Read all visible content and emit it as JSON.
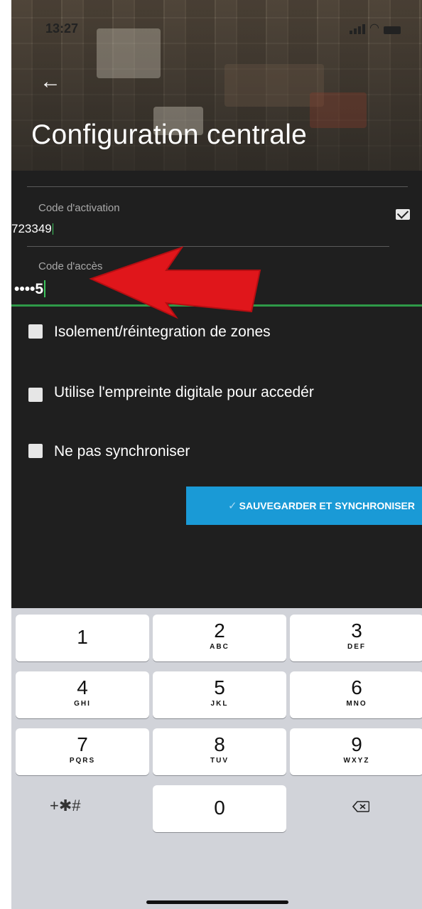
{
  "status_bar": {
    "time": "13:27"
  },
  "header": {
    "title": "Configuration centrale"
  },
  "form": {
    "activation": {
      "label": "Code d'activation",
      "value": "723349"
    },
    "access": {
      "label": "Code d'accès",
      "value": "••••5"
    }
  },
  "options": [
    {
      "label": "Isolement/réintegration de zones",
      "checked": false
    },
    {
      "label": "Utilise l'empreinte digitale pour accedér",
      "checked": false
    },
    {
      "label": "Ne pas synchroniser",
      "checked": false
    }
  ],
  "save_button": {
    "label": "SAUVEGARDER ET SYNCHRONISER"
  },
  "keyboard": {
    "keys": [
      {
        "digit": "1",
        "letters": ""
      },
      {
        "digit": "2",
        "letters": "ABC"
      },
      {
        "digit": "3",
        "letters": "DEF"
      },
      {
        "digit": "4",
        "letters": "GHI"
      },
      {
        "digit": "5",
        "letters": "JKL"
      },
      {
        "digit": "6",
        "letters": "MNO"
      },
      {
        "digit": "7",
        "letters": "PQRS"
      },
      {
        "digit": "8",
        "letters": "TUV"
      },
      {
        "digit": "9",
        "letters": "WXYZ"
      },
      {
        "digit": "0",
        "letters": ""
      }
    ],
    "symbols_label": "+✱#"
  },
  "colors": {
    "background": "#1f1f1f",
    "accent": "#1a9ad6",
    "focus_underline": "#2e9a48",
    "annotation_arrow": "#e0161b"
  },
  "icons": [
    "back-arrow-icon",
    "mail-icon",
    "annotation-arrow-icon",
    "delete-icon",
    "checkmark-icon"
  ]
}
